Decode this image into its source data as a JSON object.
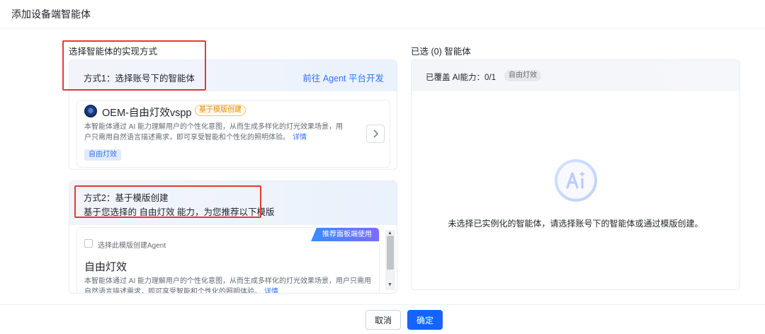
{
  "dialog": {
    "title": "添加设备端智能体"
  },
  "left": {
    "section_label": "选择智能体的实现方式",
    "method1": {
      "title": "方式1：选择账号下的智能体",
      "link": "前往 Agent 平台开发",
      "agent": {
        "name": "OEM-自由灯效vspp",
        "badge": "基于模版创建",
        "description": "本智能体通过 AI 能力理解用户的个性化意图，从而生成多样化的灯光效果场景，用户只需用自然语言描述需求，即可享受智能和个性化的照明体验。",
        "detail_link": "详情",
        "capability_tag": "自由灯效",
        "icon": "chevron-right-icon"
      }
    },
    "method2": {
      "title": "方式2：基于模版创建",
      "subtitle": "基于您选择的 自由灯效 能力，为您推荐以下模版",
      "template": {
        "ribbon": "推荐面板端使用",
        "checkbox_label": "选择此模版创建Agent",
        "checked": false,
        "name": "自由灯效",
        "description": "本智能体通过 AI 能力理解用户的个性化意图，从而生成多样化的灯光效果场景，用户只需用自然语言描述需求，即可享受智能和个性化的照明体验。",
        "detail_link": "详情"
      }
    }
  },
  "right": {
    "selected_label": "已选 (0) 智能体",
    "coverage": "已覆盖 AI能力：0/1",
    "coverage_tag": "自由灯效",
    "empty_icon": "ai-icon",
    "empty_text": "未选择已实例化的智能体，请选择账号下的智能体或通过模版创建。"
  },
  "footer": {
    "cancel": "取消",
    "confirm": "确定"
  },
  "colors": {
    "primary": "#1664ff",
    "link": "#3370ff",
    "annotation_red": "#e53935",
    "badge_orange": "#e08a00"
  }
}
